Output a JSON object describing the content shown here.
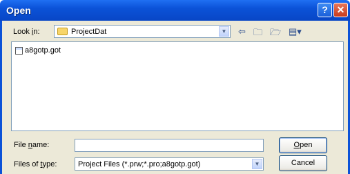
{
  "window": {
    "title": "Open",
    "help_label": "?",
    "close_label": "✕"
  },
  "look_in": {
    "label_pre": "Look ",
    "label_key": "i",
    "label_post": "n:",
    "value": "ProjectDat"
  },
  "toolbar": {
    "back_icon": "back-arrow-icon",
    "up_icon": "up-folder-icon",
    "new_folder_icon": "new-folder-icon",
    "view_menu_icon": "view-menu-icon"
  },
  "files": [
    {
      "name": "a8gotp.got",
      "icon": "document-icon"
    }
  ],
  "file_name": {
    "label_pre": "File ",
    "label_key": "n",
    "label_post": "ame:",
    "value": ""
  },
  "file_type": {
    "label_pre": "Files of ",
    "label_key": "t",
    "label_post": "ype:",
    "value": "Project Files (*.prw;*.pro;a8gotp.got)"
  },
  "buttons": {
    "open_key": "O",
    "open_rest": "pen",
    "cancel": "Cancel"
  }
}
